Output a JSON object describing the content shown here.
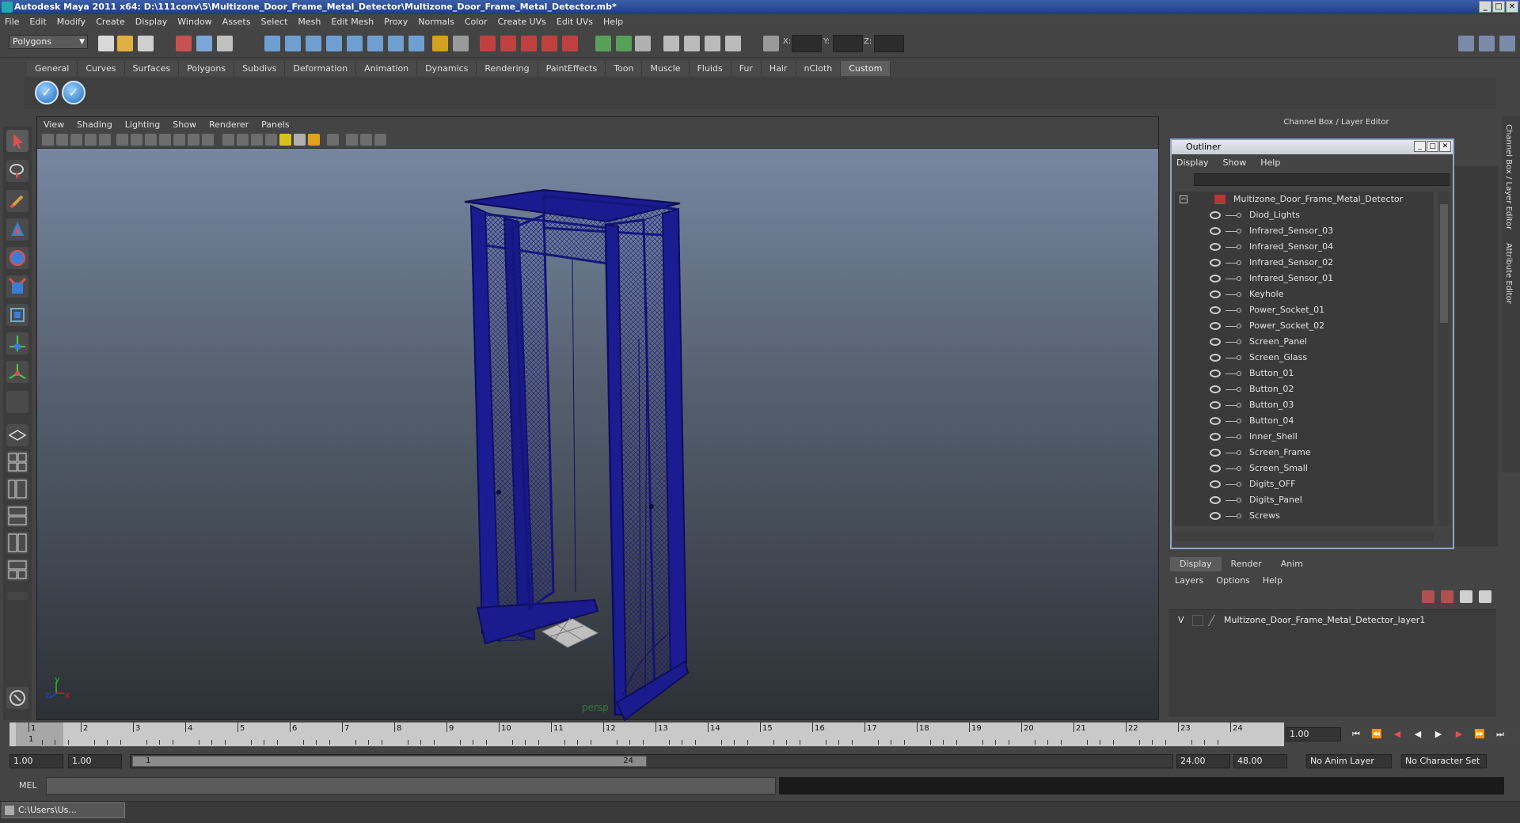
{
  "window": {
    "title": "Autodesk Maya 2011 x64: D:\\111conv\\5\\Multizone_Door_Frame_Metal_Detector\\Multizone_Door_Frame_Metal_Detector.mb*"
  },
  "menu": [
    "File",
    "Edit",
    "Modify",
    "Create",
    "Display",
    "Window",
    "Assets",
    "Select",
    "Mesh",
    "Edit Mesh",
    "Proxy",
    "Normals",
    "Color",
    "Create UVs",
    "Edit UVs",
    "Help"
  ],
  "status": {
    "mode": "Polygons",
    "x_label": "X:",
    "y_label": "Y:",
    "z_label": "Z:"
  },
  "shelf": {
    "tabs": [
      "General",
      "Curves",
      "Surfaces",
      "Polygons",
      "Subdivs",
      "Deformation",
      "Animation",
      "Dynamics",
      "Rendering",
      "PaintEffects",
      "Toon",
      "Muscle",
      "Fluids",
      "Fur",
      "Hair",
      "nCloth",
      "Custom"
    ],
    "active": "Custom"
  },
  "viewport": {
    "menu": [
      "View",
      "Shading",
      "Lighting",
      "Show",
      "Renderer",
      "Panels"
    ],
    "camera": "persp",
    "axis_y": "y",
    "axis_x": "x",
    "axis_z": "z",
    "mesh_color": "#1a1a8c"
  },
  "channel_box": {
    "header": "Channel Box / Layer Editor",
    "side_tabs": [
      "Channel Box / Layer Editor",
      "Attribute Editor"
    ]
  },
  "outliner": {
    "title": "Outliner",
    "menu": [
      "Display",
      "Show",
      "Help"
    ],
    "root": "Multizone_Door_Frame_Metal_Detector",
    "items": [
      "Diod_Lights",
      "Infrared_Sensor_03",
      "Infrared_Sensor_04",
      "Infrared_Sensor_02",
      "Infrared_Sensor_01",
      "Keyhole",
      "Power_Socket_01",
      "Power_Socket_02",
      "Screen_Panel",
      "Screen_Glass",
      "Button_01",
      "Button_02",
      "Button_03",
      "Button_04",
      "Inner_Shell",
      "Screen_Frame",
      "Screen_Small",
      "Digits_OFF",
      "Digits_Panel",
      "Screws"
    ]
  },
  "layers": {
    "tabs": [
      "Display",
      "Render",
      "Anim"
    ],
    "active": "Display",
    "menu": [
      "Layers",
      "Options",
      "Help"
    ],
    "rows": [
      {
        "visible": "V",
        "name": "Multizone_Door_Frame_Metal_Detector_layer1"
      }
    ]
  },
  "timeline": {
    "ticks": [
      "1",
      "2",
      "3",
      "4",
      "5",
      "6",
      "7",
      "8",
      "9",
      "10",
      "11",
      "12",
      "13",
      "14",
      "15",
      "16",
      "17",
      "18",
      "19",
      "20",
      "21",
      "22",
      "23",
      "24"
    ],
    "current_marker": "1",
    "current_frame": "1.00"
  },
  "range": {
    "start": "1.00",
    "start2": "1.00",
    "thumb_start": "1",
    "thumb_end": "24",
    "end": "24.00",
    "end2": "48.00",
    "anim_layer": "No Anim Layer",
    "char_set": "No Character Set"
  },
  "command": {
    "label": "MEL"
  },
  "taskbar": {
    "item": "C:\\Users\\Us..."
  }
}
